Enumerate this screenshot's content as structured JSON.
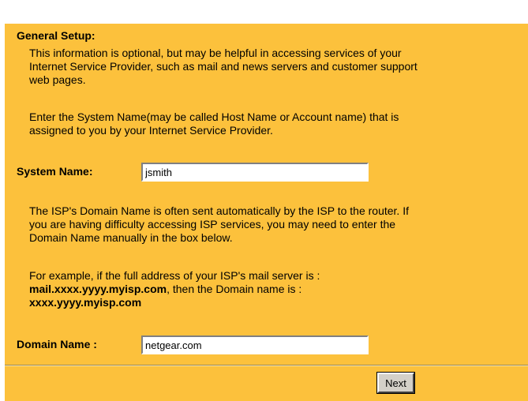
{
  "general_setup": {
    "heading": "General Setup:",
    "intro_line1": "This information is optional, but may be helpful in accessing services of your",
    "intro_line2": "Internet Service Provider, such as mail and news servers and customer support",
    "intro_line3": "web pages.",
    "enter_line1": "Enter the System Name(may be called Host Name or Account name) that is",
    "enter_line2": "assigned to you by your Internet Service Provider."
  },
  "system_name": {
    "label": "System Name:",
    "value": "jsmith"
  },
  "domain_info": {
    "line1": "The ISP's Domain Name is often sent automatically by the ISP to the router. If",
    "line2": "you are having difficulty accessing ISP services, you may need to enter the",
    "line3": "Domain Name manually in the box below.",
    "example_line1": "For example, if the full address of your ISP's mail server is :",
    "example_server": "mail.xxxx.yyyy.myisp.com",
    "example_then": ", then the Domain name is :",
    "example_domain": "xxxx.yyyy.myisp.com"
  },
  "domain_name": {
    "label": "Domain Name :",
    "value": "netgear.com"
  },
  "actions": {
    "next_label": "Next"
  },
  "colors": {
    "panel_background": "#fcc13c",
    "page_background": "#ffffff",
    "button_face": "#d4d0c8"
  }
}
